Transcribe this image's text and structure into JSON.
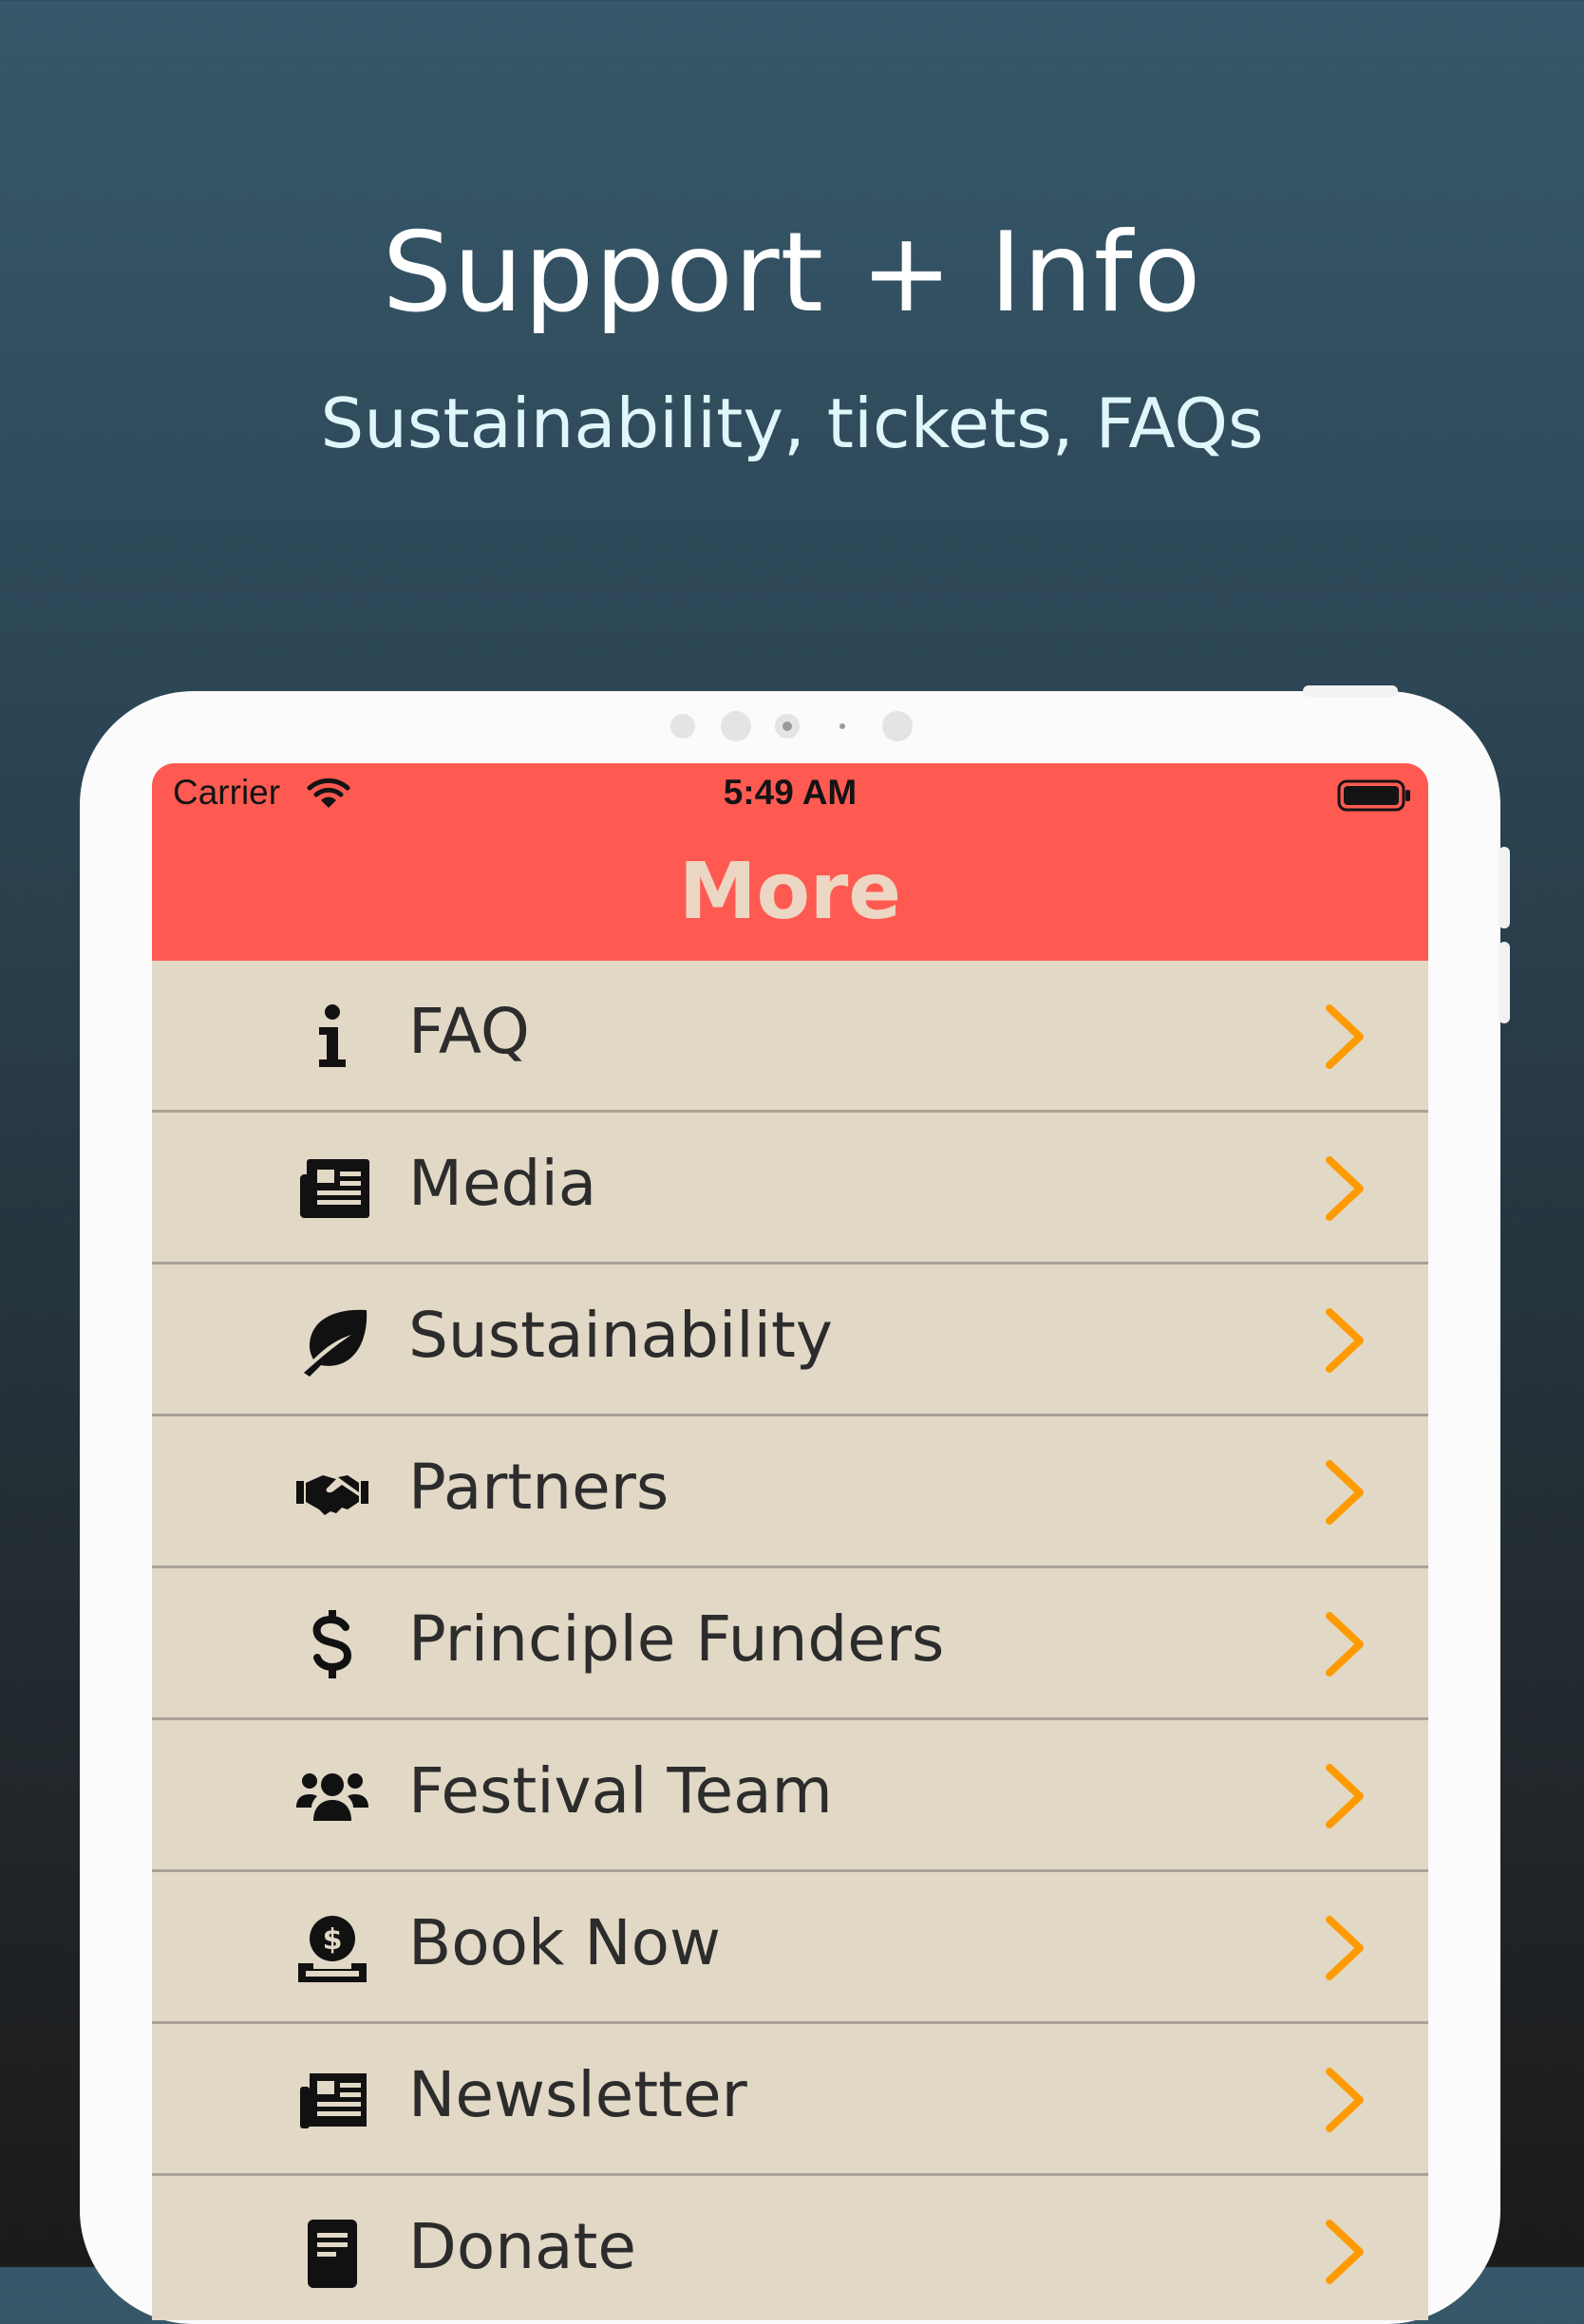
{
  "hero": {
    "title": "Support + Info",
    "subtitle": "Sustainability, tickets, FAQs"
  },
  "status_bar": {
    "carrier": "Carrier",
    "time": "5:49 AM"
  },
  "nav": {
    "title": "More"
  },
  "colors": {
    "nav_bar": "#ff5a51",
    "nav_title": "#ecd7c4",
    "row_background": "#e1d8c6",
    "chevron": "#ff9b00"
  },
  "menu": {
    "items": [
      {
        "label": "FAQ",
        "icon": "info-icon"
      },
      {
        "label": "Media",
        "icon": "newspaper-icon"
      },
      {
        "label": "Sustainability",
        "icon": "leaf-icon"
      },
      {
        "label": "Partners",
        "icon": "handshake-icon"
      },
      {
        "label": "Principle Funders",
        "icon": "dollar-icon"
      },
      {
        "label": "Festival Team",
        "icon": "users-icon"
      },
      {
        "label": "Book Now",
        "icon": "donate-coin-icon"
      },
      {
        "label": "Newsletter",
        "icon": "newspaper-icon"
      },
      {
        "label": "Donate",
        "icon": "receipt-icon"
      }
    ]
  }
}
